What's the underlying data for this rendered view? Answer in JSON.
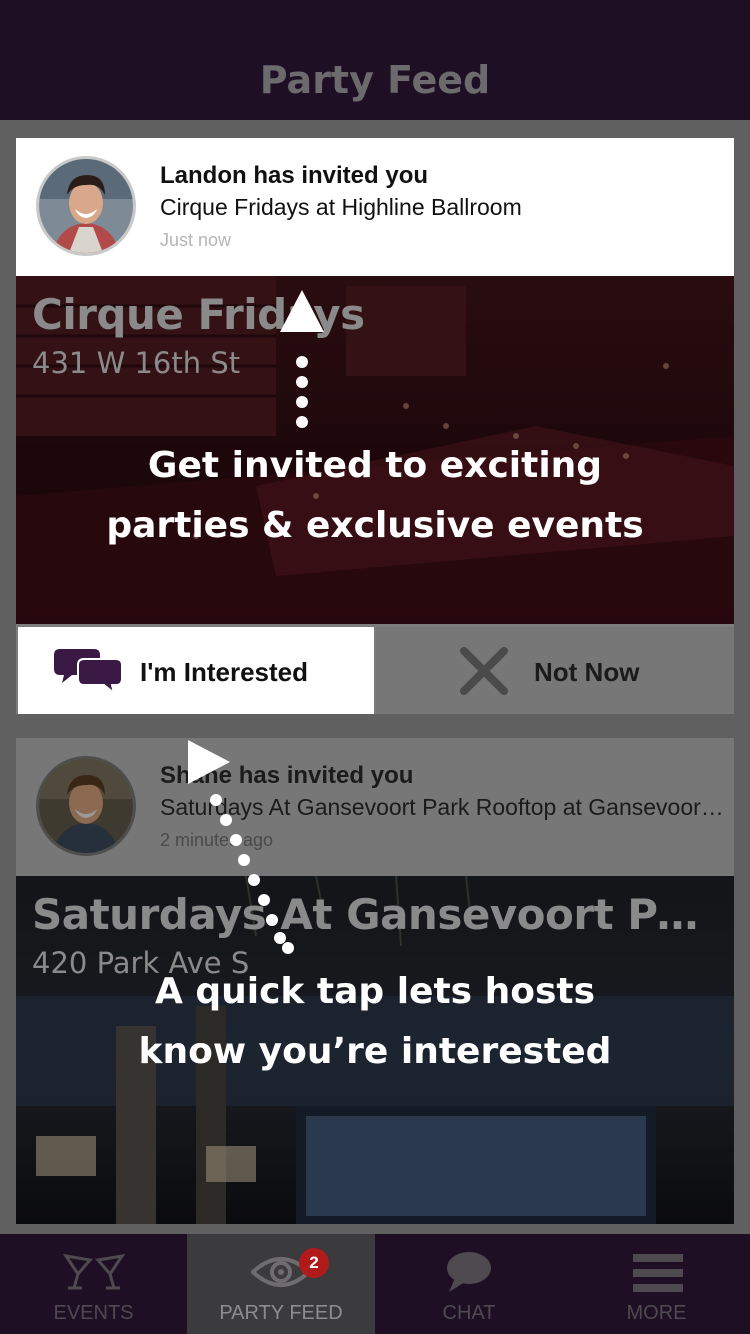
{
  "header": {
    "title": "Party Feed"
  },
  "feed": [
    {
      "inviter_line": "Landon has invited you",
      "event_line": "Cirque Fridays at Highline Ballroom",
      "time": "Just now",
      "event_title": "Cirque Fridays",
      "address": "431 W 16th St",
      "interested_label": "I'm Interested",
      "not_now_label": "Not Now"
    },
    {
      "inviter_line": "Shane has invited you",
      "event_line": "Saturdays At Gansevoort Park Rooftop at Gansevoort Park",
      "time": "2 minutes ago",
      "event_title": "Saturdays At Gansevoort Park Rooftop",
      "address": "420 Park Ave S"
    }
  ],
  "tutorial": {
    "tip1_line1": "Get invited to exciting",
    "tip1_line2": "parties & exclusive events",
    "tip2_line1": "A quick tap lets hosts",
    "tip2_line2": "know you’re interested"
  },
  "tabbar": {
    "tabs": [
      {
        "label": "EVENTS",
        "icon": "cocktail-glasses-icon"
      },
      {
        "label": "PARTY FEED",
        "icon": "eye-icon",
        "badge": "2",
        "active": true
      },
      {
        "label": "CHAT",
        "icon": "chat-bubble-icon"
      },
      {
        "label": "MORE",
        "icon": "hamburger-menu-icon"
      }
    ]
  },
  "colors": {
    "header_bg": "#1e0f24",
    "accent_purple": "#3a1a45",
    "badge_red": "#b01a1a"
  }
}
